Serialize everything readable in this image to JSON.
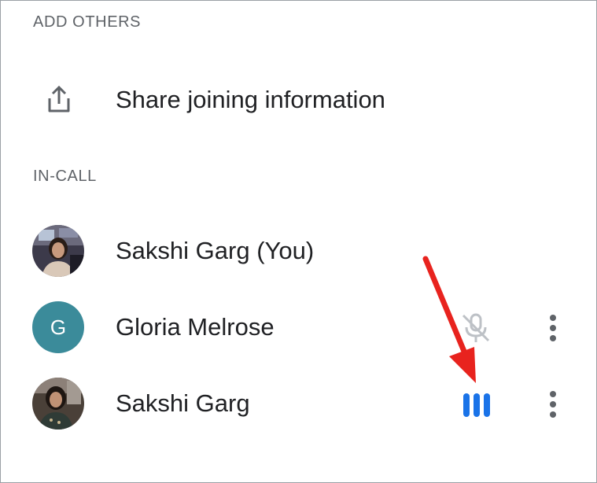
{
  "sections": {
    "add_others": "ADD OTHERS",
    "in_call": "IN-CALL"
  },
  "share": {
    "label": "Share joining information",
    "icon": "share-icon"
  },
  "participants": [
    {
      "name": "Sakshi Garg (You)",
      "avatar": "photo",
      "status_icon": null
    },
    {
      "name": "Gloria Melrose",
      "avatar_letter": "G",
      "avatar_color": "#3b8b9a",
      "status_icon": "mic-off-icon"
    },
    {
      "name": "Sakshi Garg",
      "avatar": "photo",
      "status_icon": "speaking-indicator-icon",
      "status_color": "#1a73e8"
    }
  ],
  "annotation": {
    "type": "arrow",
    "color": "#e8231e",
    "points_to": "speaking-indicator-icon"
  }
}
